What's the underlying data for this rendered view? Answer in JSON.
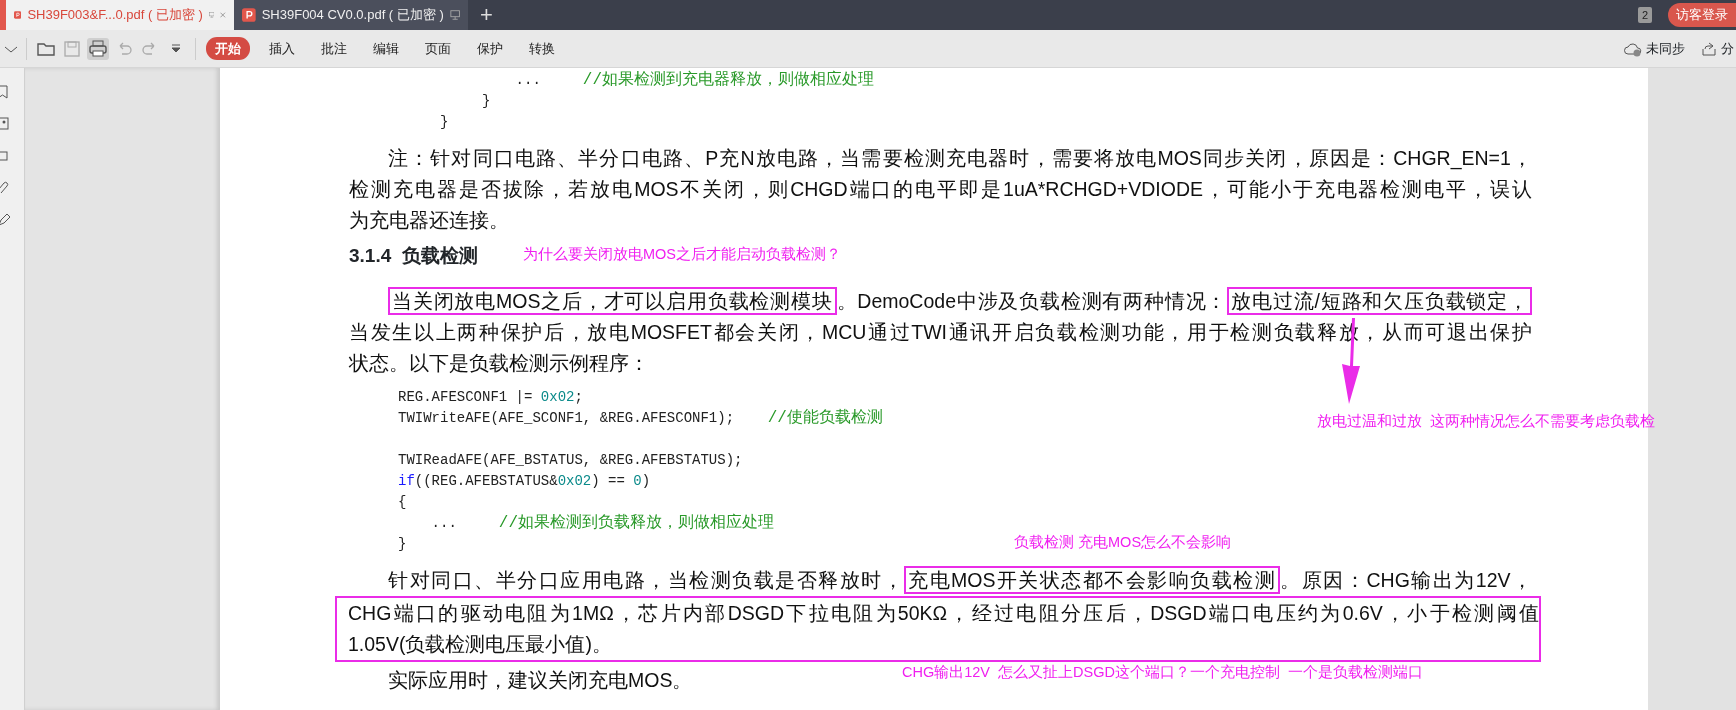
{
  "tabs": [
    {
      "title": "SH39F003&F...0.pdf ( 已加密 )",
      "selected": true,
      "closable": true
    },
    {
      "title": "SH39F004 CV0.0.pdf ( 已加密 )",
      "selected": false,
      "closable": false
    }
  ],
  "new_tab": "+",
  "window_count": "2",
  "login_button": "访客登录",
  "ribbon_tabs": [
    {
      "label": "开始",
      "selected": true
    },
    {
      "label": "插入",
      "selected": false
    },
    {
      "label": "批注",
      "selected": false
    },
    {
      "label": "编辑",
      "selected": false
    },
    {
      "label": "页面",
      "selected": false
    },
    {
      "label": "保护",
      "selected": false
    },
    {
      "label": "转换",
      "selected": false
    }
  ],
  "sync_status": "未同步",
  "share": "分",
  "document": [
    {
      "kind": "code",
      "lines": [
        [
          {
            "text": "              ...     ",
            "kind": "plain"
          },
          {
            "text": "//如果检测到充电器释放，则做相应处理",
            "kind": "comment"
          }
        ],
        [
          {
            "text": "          }",
            "kind": "plain"
          }
        ],
        [
          {
            "text": "     }",
            "kind": "plain"
          }
        ]
      ]
    },
    {
      "kind": "paragraph",
      "lines": [
        {
          "in_box": false,
          "segments": [
            {
              "text": "注：针对同口电路、半分口电路、P充N放电路，当需要检测充电器时，需要将放电MOS同步关闭，原因是：CHGR_EN=1，",
              "boxed": false
            }
          ]
        },
        {
          "in_box": false,
          "segments": [
            {
              "text": "检测充电器是否拔除，若放电MOS不关闭，则CHGD端口的电平即是1uA*RCHGD+VDIODE，可能小于充电器检测电平，误认",
              "boxed": false
            }
          ]
        },
        {
          "in_box": false,
          "segments": [
            {
              "text": "为充电器还连接。",
              "boxed": false
            }
          ]
        }
      ]
    },
    {
      "kind": "heading",
      "text": "3.1.4  负载检测"
    },
    {
      "kind": "paragraph",
      "lines": [
        {
          "in_box": false,
          "segments": [
            {
              "text": "当关闭放电MOS之后，才可以启用负载检测模块",
              "boxed": true
            },
            {
              "text": "。DemoCode中涉及负载检测有两种情况：",
              "boxed": false
            },
            {
              "text": "放电过流/短路和欠压负载锁定，",
              "boxed": true
            }
          ]
        },
        {
          "in_box": false,
          "segments": [
            {
              "text": "当发生以上两种保护后，放电MOSFET都会关闭，MCU通过TWI通讯开启负载检测功能，用于检测负载释放，从而可退出保护",
              "boxed": false
            }
          ]
        },
        {
          "in_box": false,
          "segments": [
            {
              "text": "状态。以下是负载检测示例程序：",
              "boxed": false
            }
          ]
        }
      ]
    },
    {
      "kind": "code",
      "lines": [
        [
          {
            "text": "REG.AFESCONF1 |= ",
            "kind": "plain"
          },
          {
            "text": "0x02",
            "kind": "number"
          },
          {
            "text": ";",
            "kind": "plain"
          }
        ],
        [
          {
            "text": "TWIWriteAFE(AFE_SCONF1, &REG.AFESCONF1);    ",
            "kind": "plain"
          },
          {
            "text": "//使能负载检测",
            "kind": "comment"
          }
        ]
      ]
    },
    {
      "kind": "code",
      "lines": [
        [
          {
            "text": "TWIReadAFE(AFE_BSTATUS, &REG.AFEBSTATUS);",
            "kind": "plain"
          }
        ],
        [
          {
            "text": "if",
            "kind": "keyword"
          },
          {
            "text": "((REG.AFEBSTATUS&",
            "kind": "plain"
          },
          {
            "text": "0x02",
            "kind": "number"
          },
          {
            "text": ") == ",
            "kind": "plain"
          },
          {
            "text": "0",
            "kind": "number"
          },
          {
            "text": ")",
            "kind": "plain"
          }
        ],
        [
          {
            "text": "{",
            "kind": "plain"
          }
        ],
        [
          {
            "text": "    ...     ",
            "kind": "plain"
          },
          {
            "text": "//如果检测到负载释放，则做相应处理",
            "kind": "comment"
          }
        ],
        [
          {
            "text": "}",
            "kind": "plain"
          }
        ]
      ]
    },
    {
      "kind": "paragraph",
      "lines": [
        {
          "in_box": false,
          "segments": [
            {
              "text": "针对同口、半分口应用电路，当检测负载是否释放时，",
              "boxed": false
            },
            {
              "text": "充电MOS开关状态都不会影响负载检测",
              "boxed": true
            },
            {
              "text": "。原因：CHG输出为12V，",
              "boxed": false
            }
          ]
        },
        {
          "in_box": true,
          "segments": [
            {
              "text": "CHG端口的驱动电阻为1MΩ，芯片内部DSGD下拉电阻为50KΩ，经过电阻分压后，DSGD端口电压约为0.6V，小于检测阈值",
              "boxed": false
            }
          ]
        },
        {
          "in_box": true,
          "segments": [
            {
              "text": "1.05V(负载检测电压最小值)。",
              "boxed": false
            }
          ]
        }
      ]
    },
    {
      "kind": "paragraph",
      "lines": [
        {
          "in_box": false,
          "segments": [
            {
              "text": "实际应用时，建议关闭充电MOS。",
              "boxed": false
            }
          ]
        }
      ]
    }
  ],
  "annotations": [
    {
      "kind": "note",
      "text": "为什么要关闭放电MOS之后才能启动负载检测？"
    },
    {
      "kind": "arrow"
    },
    {
      "kind": "note",
      "text": "放电过温和过放  这两种情况怎么不需要考虑负载检"
    },
    {
      "kind": "note",
      "text": "负载检测 充电MOS怎么不会影响"
    },
    {
      "kind": "note",
      "text": "CHG输出12V  怎么又扯上DSGD这个端口？一个充电控制  一个是负载检测端口"
    }
  ]
}
